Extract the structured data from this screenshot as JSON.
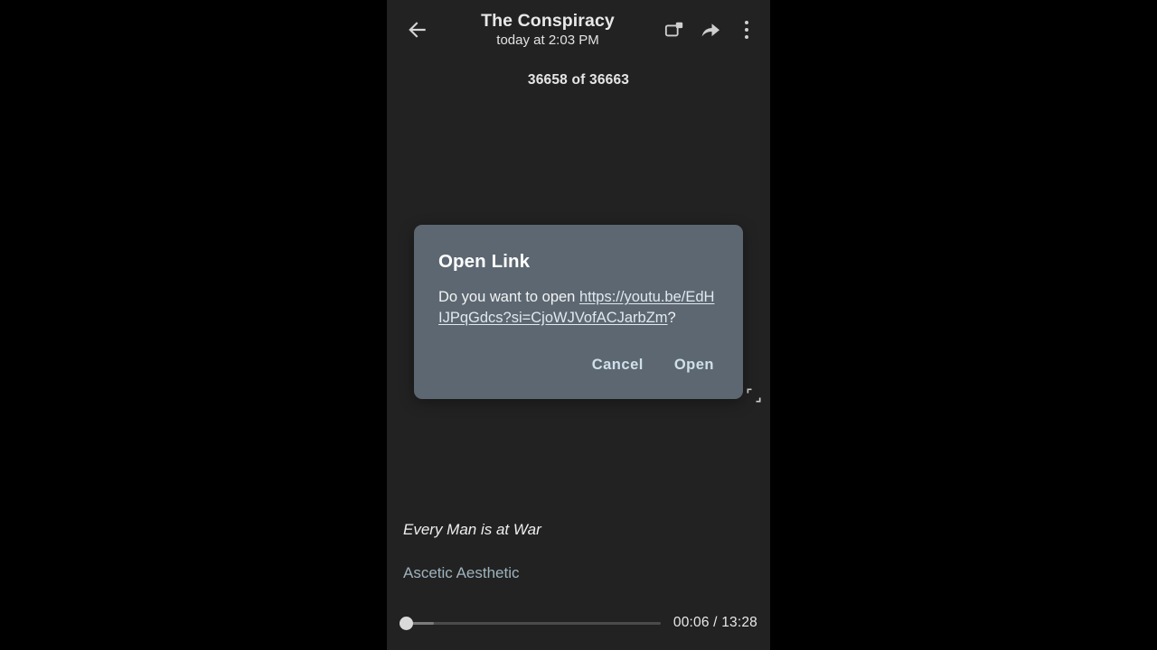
{
  "appbar": {
    "back_icon": "arrow-left-icon",
    "title": "The Conspiracy",
    "subtitle": "today at 2:03 PM",
    "pip_icon": "picture-in-picture-icon",
    "share_icon": "share-arrow-icon",
    "overflow_icon": "kebab-menu-icon"
  },
  "viewer": {
    "page_counter": "36658 of 36663",
    "fullscreen_icon": "fullscreen-expand-icon"
  },
  "dialog": {
    "title": "Open Link",
    "prompt_prefix": "Do you want to open ",
    "url": "https://youtu.be/EdHIJPqGdcs?si=CjoWJVofACJarbZm",
    "prompt_suffix": "?",
    "cancel_label": "Cancel",
    "open_label": "Open"
  },
  "player": {
    "track_title": "Every Man is at War",
    "artist": "Ascetic Aesthetic",
    "current_time": "00:06",
    "duration": "13:28",
    "time_display": "00:06 / 13:28"
  },
  "colors": {
    "letterbox": "#000000",
    "panel_background": "#222222",
    "dialog_background": "#5d6771",
    "dialog_action": "#cfe0ea",
    "artist_text": "#9fb3bd",
    "link_text": "#dfe9ef"
  }
}
